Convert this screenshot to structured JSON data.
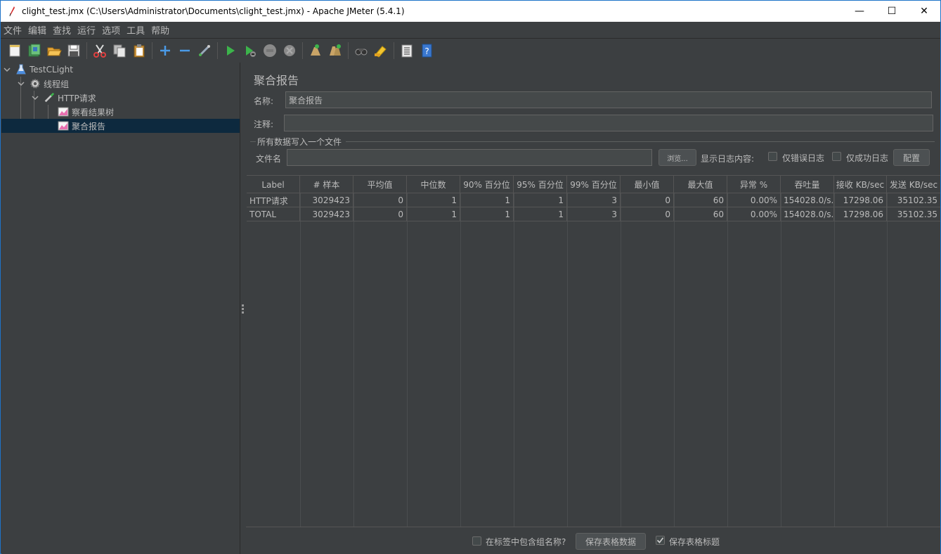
{
  "window": {
    "title": "clight_test.jmx (C:\\Users\\Administrator\\Documents\\clight_test.jmx) - Apache JMeter (5.4.1)",
    "minimize_glyph": "—",
    "maximize_glyph": "☐",
    "close_glyph": "✕"
  },
  "menu": [
    "文件",
    "编辑",
    "查找",
    "运行",
    "选项",
    "工具",
    "帮助"
  ],
  "toolbar": {
    "icons": [
      "new-icon",
      "templates-icon",
      "open-icon",
      "save-icon",
      "cut-icon",
      "copy-icon",
      "paste-icon",
      "expand-icon",
      "collapse-icon",
      "toggle-icon",
      "start-icon",
      "start-no-pause-icon",
      "stop-icon",
      "shutdown-icon",
      "clear-icon",
      "clear-all-icon",
      "search-icon",
      "reset-search-icon",
      "function-helper-icon",
      "help-icon"
    ]
  },
  "tree": {
    "nodes": [
      {
        "label": "TestCLight",
        "icon": "test-plan-icon"
      },
      {
        "label": "线程组",
        "icon": "thread-group-gear-icon"
      },
      {
        "label": "HTTP请求",
        "icon": "sampler-pipette-icon"
      },
      {
        "label": "察看结果树",
        "icon": "listener-chart-icon"
      },
      {
        "label": "聚合报告",
        "icon": "listener-chart-icon"
      }
    ]
  },
  "panel": {
    "title": "聚合报告",
    "name_label": "名称:",
    "name_value": "聚合报告",
    "comment_label": "注释:",
    "comment_value": "",
    "file_group_title": "所有数据写入一个文件",
    "filename_label": "文件名",
    "filename_value": "",
    "browse_label": "浏览...",
    "log_content_label": "显示日志内容:",
    "errors_only_label": "仅错误日志",
    "success_only_label": "仅成功日志",
    "configure_label": "配置"
  },
  "table": {
    "headers": [
      "Label",
      "# 样本",
      "平均值",
      "中位数",
      "90% 百分位",
      "95% 百分位",
      "99% 百分位",
      "最小值",
      "最大值",
      "异常 %",
      "吞吐量",
      "接收 KB/sec",
      "发送 KB/sec"
    ],
    "rows": [
      [
        "HTTP请求",
        "3029423",
        "0",
        "1",
        "1",
        "1",
        "3",
        "0",
        "60",
        "0.00%",
        "154028.0/s...",
        "17298.06",
        "35102.35"
      ],
      [
        "TOTAL",
        "3029423",
        "0",
        "1",
        "1",
        "1",
        "3",
        "0",
        "60",
        "0.00%",
        "154028.0/s...",
        "17298.06",
        "35102.35"
      ]
    ]
  },
  "footer": {
    "include_group_label": "在标签中包含组名称?",
    "save_table_label": "保存表格数据",
    "save_header_label": "保存表格标题",
    "save_header_checked": true
  }
}
